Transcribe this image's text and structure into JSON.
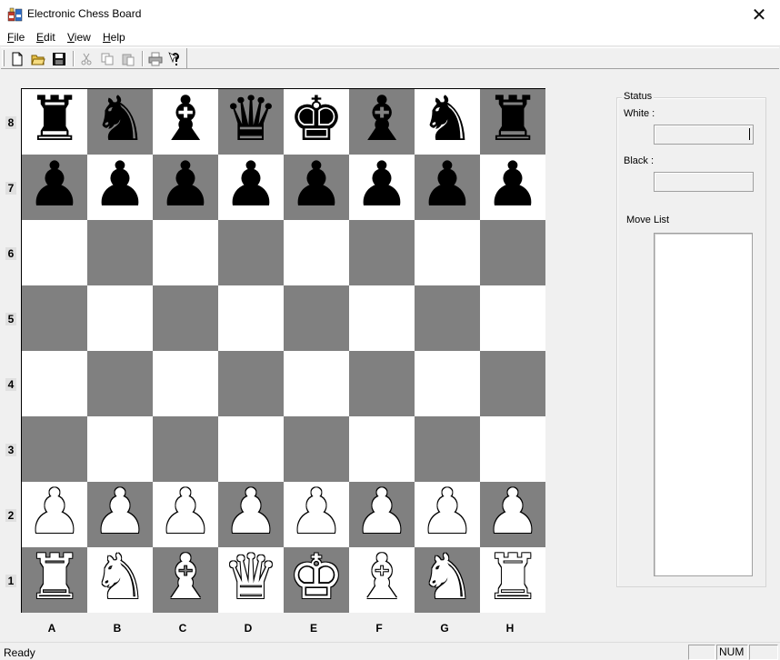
{
  "window": {
    "title": "Electronic Chess Board",
    "close_glyph": "✕"
  },
  "menu": {
    "items": [
      {
        "label_rest": "ile",
        "mnemonic": "F"
      },
      {
        "label_rest": "dit",
        "mnemonic": "E"
      },
      {
        "label_rest": "iew",
        "mnemonic": "V"
      },
      {
        "label_rest": "elp",
        "mnemonic": "H"
      }
    ]
  },
  "toolbar": {
    "buttons": [
      "new-file-icon",
      "open-folder-icon",
      "save-disk-icon",
      "cut-icon",
      "copy-icon",
      "paste-icon",
      "print-icon",
      "help-pointer-icon"
    ]
  },
  "board": {
    "ranks": [
      "8",
      "7",
      "6",
      "5",
      "4",
      "3",
      "2",
      "1"
    ],
    "files": [
      "A",
      "B",
      "C",
      "D",
      "E",
      "F",
      "G",
      "H"
    ],
    "rows": [
      [
        "♜",
        "♞",
        "♝",
        "♛",
        "♚",
        "♝",
        "♞",
        "♜"
      ],
      [
        "♟",
        "♟",
        "♟",
        "♟",
        "♟",
        "♟",
        "♟",
        "♟"
      ],
      [
        "",
        "",
        "",
        "",
        "",
        "",
        "",
        ""
      ],
      [
        "",
        "",
        "",
        "",
        "",
        "",
        "",
        ""
      ],
      [
        "",
        "",
        "",
        "",
        "",
        "",
        "",
        ""
      ],
      [
        "",
        "",
        "",
        "",
        "",
        "",
        "",
        ""
      ],
      [
        "♟",
        "♟",
        "♟",
        "♟",
        "♟",
        "♟",
        "♟",
        "♟"
      ],
      [
        "♜",
        "♞",
        "♝",
        "♛",
        "♚",
        "♝",
        "♞",
        "♜"
      ]
    ],
    "piece_colors": [
      [
        "black",
        "black",
        "black",
        "black",
        "black",
        "black",
        "black",
        "black"
      ],
      [
        "black",
        "black",
        "black",
        "black",
        "black",
        "black",
        "black",
        "black"
      ],
      [
        "",
        "",
        "",
        "",
        "",
        "",
        "",
        ""
      ],
      [
        "",
        "",
        "",
        "",
        "",
        "",
        "",
        ""
      ],
      [
        "",
        "",
        "",
        "",
        "",
        "",
        "",
        ""
      ],
      [
        "",
        "",
        "",
        "",
        "",
        "",
        "",
        ""
      ],
      [
        "white",
        "white",
        "white",
        "white",
        "white",
        "white",
        "white",
        "white"
      ],
      [
        "white",
        "white",
        "white",
        "white",
        "white",
        "white",
        "white",
        "white"
      ]
    ],
    "light_square_color": "#ffffff",
    "dark_square_color": "#808080"
  },
  "status_panel": {
    "group_label": "Status",
    "white_label": "White :",
    "white_value": "",
    "black_label": "Black :",
    "black_value": "",
    "move_list_label": "Move List",
    "moves": []
  },
  "statusbar": {
    "text": "Ready",
    "num_indicator": "NUM"
  }
}
